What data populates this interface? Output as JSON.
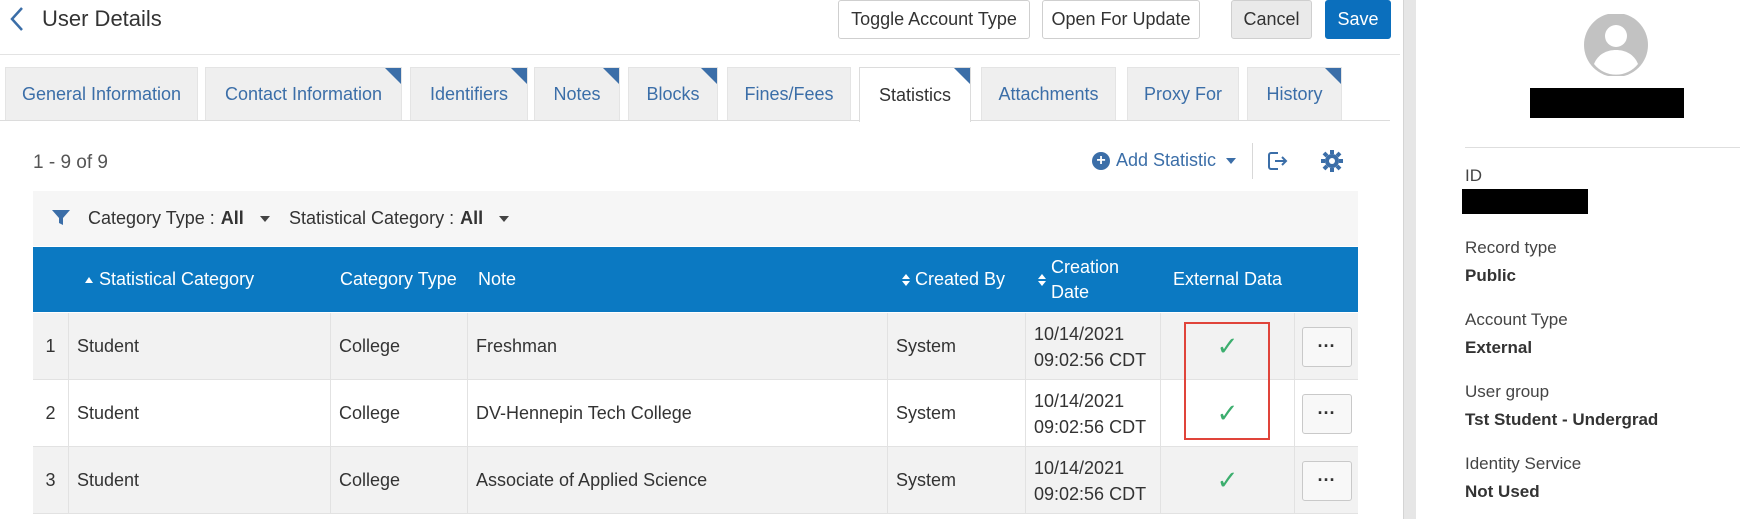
{
  "header": {
    "title": "User Details",
    "buttons": {
      "toggle_account_type": "Toggle Account Type",
      "open_for_update": "Open For Update",
      "cancel": "Cancel",
      "save": "Save"
    }
  },
  "tabs": [
    {
      "label": "General Information",
      "corner": false,
      "active": false
    },
    {
      "label": "Contact Information",
      "corner": true,
      "active": false
    },
    {
      "label": "Identifiers",
      "corner": true,
      "active": false
    },
    {
      "label": "Notes",
      "corner": true,
      "active": false
    },
    {
      "label": "Blocks",
      "corner": true,
      "active": false
    },
    {
      "label": "Fines/Fees",
      "corner": false,
      "active": false
    },
    {
      "label": "Statistics",
      "corner": true,
      "active": true
    },
    {
      "label": "Attachments",
      "corner": false,
      "active": false
    },
    {
      "label": "Proxy For",
      "corner": false,
      "active": false
    },
    {
      "label": "History",
      "corner": true,
      "active": false
    }
  ],
  "toolbar": {
    "count": "1 - 9 of 9",
    "add_statistic": "Add Statistic"
  },
  "filters": {
    "category_type_label": "Category Type :",
    "category_type_value": "All",
    "statistical_category_label": "Statistical Category :",
    "statistical_category_value": "All"
  },
  "table": {
    "columns": {
      "statistical_category": "Statistical Category",
      "category_type": "Category Type",
      "note": "Note",
      "created_by": "Created By",
      "creation_date_1": "Creation",
      "creation_date_2": "Date",
      "external_data": "External Data"
    },
    "rows": [
      {
        "num": "1",
        "category": "Student",
        "type": "College",
        "note": "Freshman",
        "created_by": "System",
        "date": "10/14/2021",
        "time": "09:02:56 CDT",
        "external": "✓",
        "actions": "···"
      },
      {
        "num": "2",
        "category": "Student",
        "type": "College",
        "note": "DV-Hennepin Tech College",
        "created_by": "System",
        "date": "10/14/2021",
        "time": "09:02:56 CDT",
        "external": "✓",
        "actions": "···"
      },
      {
        "num": "3",
        "category": "Student",
        "type": "College",
        "note": "Associate of Applied Science",
        "created_by": "System",
        "date": "10/14/2021",
        "time": "09:02:56 CDT",
        "external": "✓",
        "actions": "···"
      }
    ]
  },
  "colors": {
    "primary_blue": "#0b79c2",
    "link_blue": "#3b6ea8",
    "check_green": "#3cae6e",
    "highlight_red": "#e0443a"
  },
  "profile": {
    "id_label": "ID",
    "record_type_label": "Record type",
    "record_type_value": "Public",
    "account_type_label": "Account Type",
    "account_type_value": "External",
    "user_group_label": "User group",
    "user_group_value": "Tst Student - Undergrad",
    "identity_service_label": "Identity Service",
    "identity_service_value": "Not Used"
  }
}
